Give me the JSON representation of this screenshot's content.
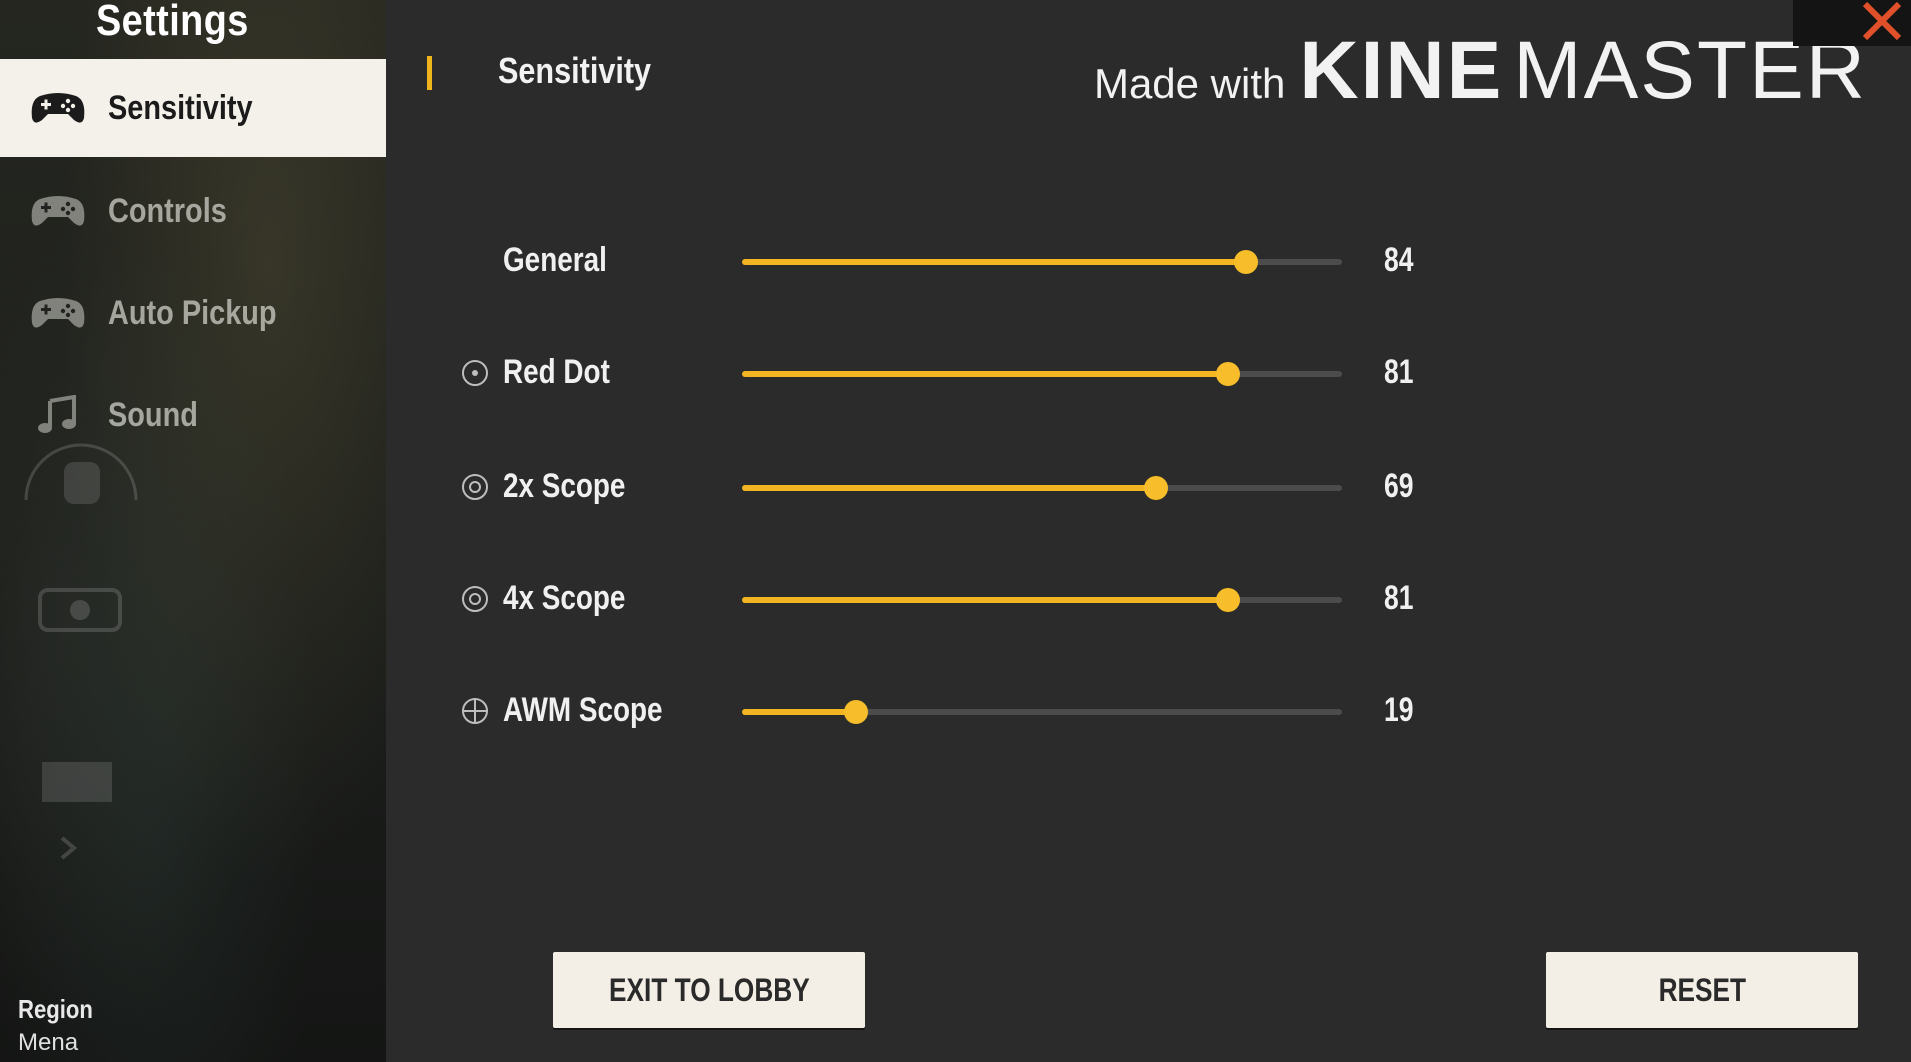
{
  "sidebar": {
    "title": "Settings",
    "items": [
      {
        "label": "Sensitivity",
        "icon": "gamepad-icon",
        "active": true
      },
      {
        "label": "Controls",
        "icon": "gamepad-icon",
        "active": false
      },
      {
        "label": "Auto Pickup",
        "icon": "gamepad-icon",
        "active": false
      },
      {
        "label": "Sound",
        "icon": "music-note-icon",
        "active": false
      }
    ],
    "region_label": "Region",
    "region_value": "Mena"
  },
  "main": {
    "section_title": "Sensitivity",
    "sliders": [
      {
        "label": "General",
        "value": "84",
        "fraction": 0.84,
        "icon": null
      },
      {
        "label": "Red Dot",
        "value": "81",
        "fraction": 0.81,
        "icon": "red-dot-icon"
      },
      {
        "label": "2x Scope",
        "value": "69",
        "fraction": 0.69,
        "icon": "scope-icon"
      },
      {
        "label": "4x Scope",
        "value": "81",
        "fraction": 0.81,
        "icon": "scope-icon"
      },
      {
        "label": "AWM Scope",
        "value": "19",
        "fraction": 0.19,
        "icon": "crosshair-icon"
      }
    ],
    "exit_label": "EXIT TO LOBBY",
    "reset_label": "RESET"
  },
  "watermark": {
    "made_with": "Made with",
    "brand_bold": "KINE",
    "brand_light": "MASTER"
  },
  "colors": {
    "accent": "#f3b522",
    "close": "#e0512b"
  }
}
